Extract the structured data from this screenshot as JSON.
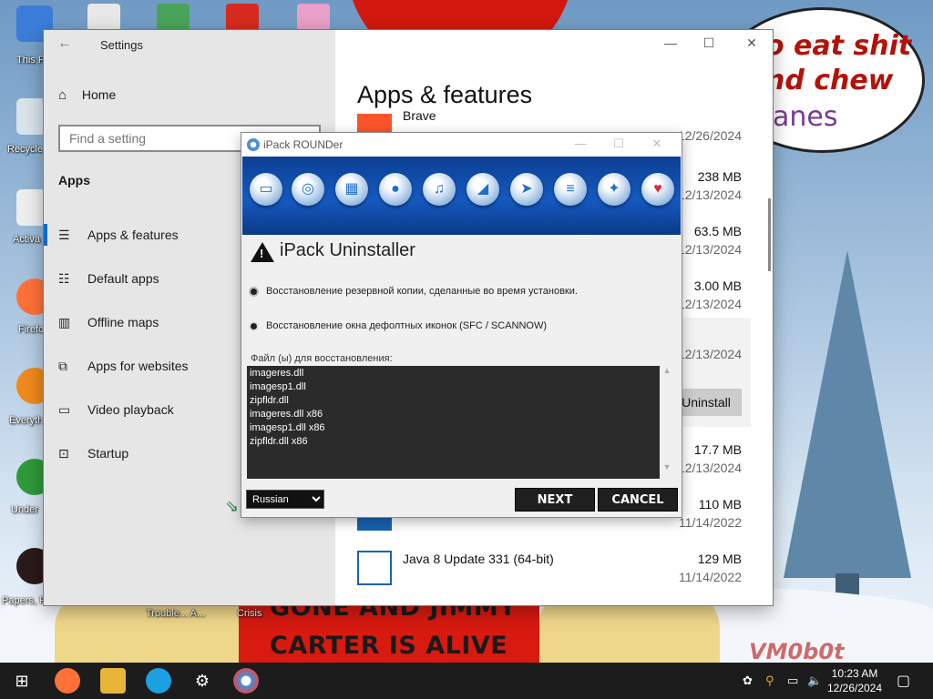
{
  "desktop": {
    "icons": [
      {
        "label": "This P"
      },
      {
        "label": "Recycle"
      },
      {
        "label": "Activa"
      },
      {
        "label": "Firefo"
      },
      {
        "label": "Everyth"
      },
      {
        "label": "Under"
      },
      {
        "label": "Papers, P"
      }
    ],
    "bottom_labels": [
      "Trouble... A...",
      "Crisis"
    ],
    "bubble_lines": [
      "o eat shit\nnd chew",
      "anes"
    ],
    "red_lines": [
      "GONE AND JIMMY",
      "CARTER IS ALIVE"
    ],
    "watermark": "VM0b0t"
  },
  "settings": {
    "window_title": "Settings",
    "home_label": "Home",
    "search_placeholder": "Find a setting",
    "section_label": "Apps",
    "nav": [
      {
        "label": "Apps & features",
        "icon": "list-icon",
        "active": true
      },
      {
        "label": "Default apps",
        "icon": "default-apps-icon"
      },
      {
        "label": "Offline maps",
        "icon": "map-icon"
      },
      {
        "label": "Apps for websites",
        "icon": "web-apps-icon"
      },
      {
        "label": "Video playback",
        "icon": "video-icon"
      },
      {
        "label": "Startup",
        "icon": "startup-icon"
      }
    ],
    "main_heading": "Apps & features",
    "apps": [
      {
        "name": "Brave",
        "size": "",
        "date": "12/26/2024"
      },
      {
        "name": "",
        "size": "238 MB",
        "date": "12/13/2024"
      },
      {
        "name": "",
        "size": "63.5 MB",
        "date": "12/13/2024"
      },
      {
        "name": "",
        "size": "3.00 MB",
        "date": "12/13/2024"
      },
      {
        "name": "",
        "size": "",
        "date": "12/13/2024",
        "selected": true
      },
      {
        "name": "",
        "size": "17.7 MB",
        "date": "12/13/2024"
      },
      {
        "name": "",
        "size": "110 MB",
        "date": "11/14/2022"
      },
      {
        "name": "Java 8 Update 331 (64-bit)",
        "size": "129 MB",
        "date": "11/14/2022"
      }
    ],
    "uninstall_label": "Uninstall"
  },
  "ipack": {
    "window_title": "iPack ROUNDer",
    "heading": "iPack Uninstaller",
    "option1": "Восстановление резервной копии, сделанные во время установки.",
    "option2": "Восстановление окна дефолтных иконок (SFC / SCANNOW)",
    "files_label": "Файл (ы) для восстановления:",
    "files": [
      "imageres.dll",
      "imagesp1.dll",
      "zipfldr.dll",
      "imageres.dll x86",
      "imagesp1.dll x86",
      "zipfldr.dll x86"
    ],
    "language": "Russian",
    "next_label": "NEXT",
    "cancel_label": "CANCEL"
  },
  "taskbar": {
    "time": "10:23 AM",
    "date": "12/26/2024",
    "apps": [
      "firefox-icon",
      "file-explorer-icon",
      "edge-icon",
      "settings-gear-icon",
      "ipack-icon"
    ]
  },
  "colors": {
    "accent": "#0a6cc4",
    "taskbar": "#1c1c1c",
    "banner": "#1559c0"
  }
}
